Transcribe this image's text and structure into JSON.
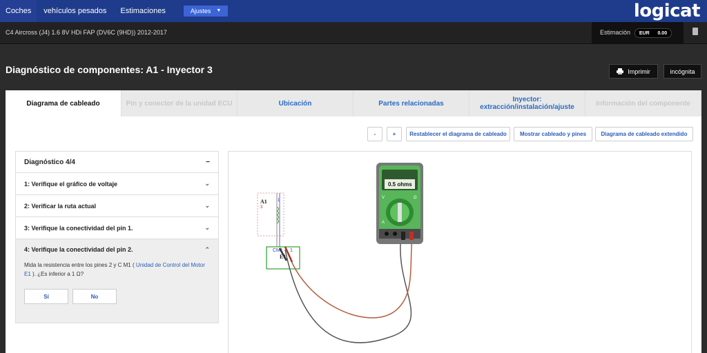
{
  "nav": {
    "items": [
      "Coches",
      "vehículos pesados",
      "Estimaciones"
    ],
    "settings": "Ajustes"
  },
  "brand": {
    "logo": "logicat"
  },
  "vehicle": {
    "name": "C4 Aircross (J4) 1.6 8V HDi FAP (DV6C (9HD)) 2012-2017"
  },
  "estimate": {
    "label": "Estimación",
    "currency": "EUR",
    "amount": "0.00"
  },
  "page": {
    "title": "Diagnóstico de componentes: A1 - Inyector 3",
    "print_label": "Imprimir",
    "incognito_label": "incógnita"
  },
  "tabs": [
    {
      "label": "Diagrama de cableado"
    },
    {
      "label": "Pin y conector de la unidad ECU"
    },
    {
      "label": "Ubicación"
    },
    {
      "label": "Partes relacionadas"
    },
    {
      "label": "Inyector: extracción/instalación/ajuste"
    },
    {
      "label": "Información del componente"
    }
  ],
  "toolbar": {
    "zoom_out": "-",
    "zoom_in": "+",
    "reset": "Restablecer el diagrama de cableado",
    "show": "Mostrar cableado y pines",
    "extended": "Diagrama de cableado extendido"
  },
  "diagnosis": {
    "header": "Diagnóstico 4/4",
    "collapse": "−",
    "steps": [
      {
        "label": "1: Verifique el gráfico de voltaje"
      },
      {
        "label": "2: Verificar la ruta actual"
      },
      {
        "label": "3: Verifique la conectividad del pin 1."
      }
    ],
    "open_step": {
      "label": "4: Verifique la conectividad del pin 2.",
      "text_a": "Mida la resistencia entre los pines 2 y C M1 (",
      "link": "Unidad de Control del Motor E1",
      "text_b": "). ¿Es inferior a 1 Ω?",
      "yes": "Sí",
      "no": "No"
    }
  },
  "multimeter": {
    "reading": "0.5 ohms",
    "v": "V",
    "ohm": "Ω",
    "a": "A"
  },
  "schematic": {
    "component": "A1",
    "pin_left": "3",
    "pin_right": "1",
    "connector": "CM1",
    "pin_conn": "1",
    "ecu": "E1"
  }
}
